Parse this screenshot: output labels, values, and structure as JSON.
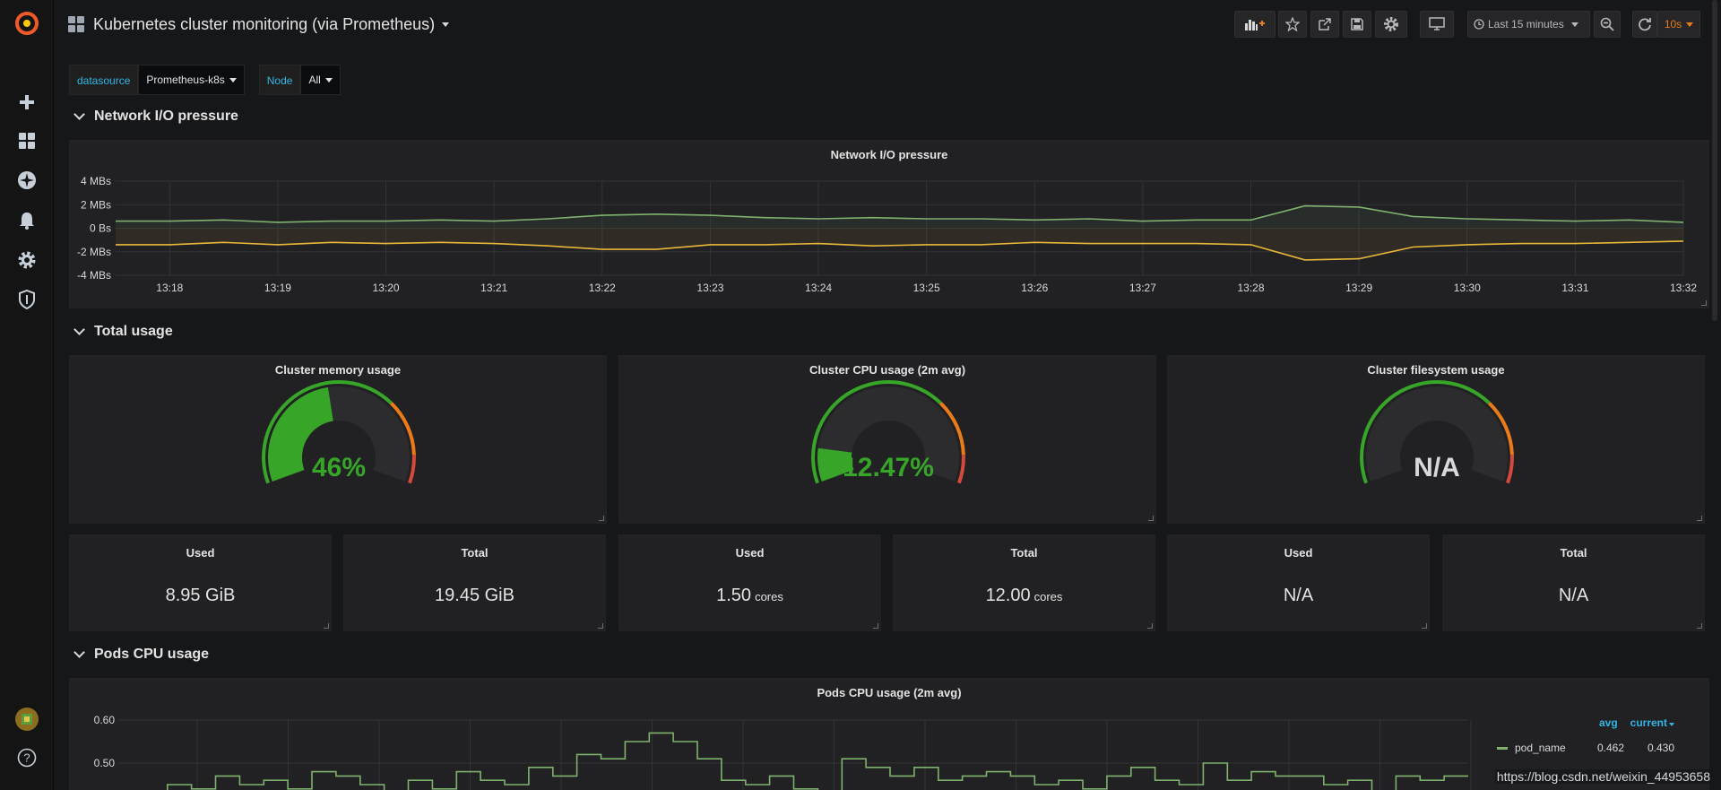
{
  "header": {
    "title": "Kubernetes cluster monitoring (via Prometheus)",
    "time_range": "Last 15 minutes",
    "refresh": "10s"
  },
  "variables": [
    {
      "label": "datasource",
      "value": "Prometheus-k8s"
    },
    {
      "label": "Node",
      "value": "All"
    }
  ],
  "rows": {
    "network": "Network I/O pressure",
    "total": "Total usage",
    "pods": "Pods CPU usage"
  },
  "network_panel": {
    "title": "Network I/O pressure",
    "y_ticks": [
      "4 MBs",
      "2 MBs",
      "0 Bs",
      "-2 MBs",
      "-4 MBs"
    ],
    "x_ticks": [
      "13:18",
      "13:19",
      "13:20",
      "13:21",
      "13:22",
      "13:23",
      "13:24",
      "13:25",
      "13:26",
      "13:27",
      "13:28",
      "13:29",
      "13:30",
      "13:31",
      "13:32"
    ]
  },
  "gauges": [
    {
      "title": "Cluster memory usage",
      "value_text": "46%",
      "fraction": 0.46,
      "color": "#37a628"
    },
    {
      "title": "Cluster CPU usage (2m avg)",
      "value_text": "12.47%",
      "fraction": 0.1247,
      "color": "#37a628"
    },
    {
      "title": "Cluster filesystem usage",
      "value_text": "N/A",
      "fraction": 0,
      "color": "#d8d9da"
    }
  ],
  "stats": [
    {
      "title": "Used",
      "value": "8.95 GiB",
      "unit": ""
    },
    {
      "title": "Total",
      "value": "19.45 GiB",
      "unit": ""
    },
    {
      "title": "Used",
      "value": "1.50",
      "unit": "cores"
    },
    {
      "title": "Total",
      "value": "12.00",
      "unit": "cores"
    },
    {
      "title": "Used",
      "value": "N/A",
      "unit": ""
    },
    {
      "title": "Total",
      "value": "N/A",
      "unit": ""
    }
  ],
  "pods_panel": {
    "title": "Pods CPU usage (2m avg)",
    "y_ticks": [
      "0.60",
      "0.50"
    ],
    "legend": {
      "avg_label": "avg",
      "current_label": "current",
      "series": [
        {
          "name": "pod_name",
          "avg": "0.462",
          "current": "0.430"
        }
      ]
    }
  },
  "colors": {
    "accent": "#33b5e5",
    "ok": "#37a628",
    "warn": "#eb7b18",
    "crit": "#d44a3a",
    "series_green": "#7eb26d",
    "series_yellow": "#eab839",
    "refresh": "#eb7b18"
  },
  "chart_data": [
    {
      "type": "line",
      "title": "Network I/O pressure",
      "x": [
        "13:17:30",
        "13:18",
        "13:18:30",
        "13:19",
        "13:19:30",
        "13:20",
        "13:20:30",
        "13:21",
        "13:21:30",
        "13:22",
        "13:22:30",
        "13:23",
        "13:23:30",
        "13:24",
        "13:24:30",
        "13:25",
        "13:25:30",
        "13:26",
        "13:26:30",
        "13:27",
        "13:27:30",
        "13:28",
        "13:28:30",
        "13:29",
        "13:29:30",
        "13:30",
        "13:30:30",
        "13:31",
        "13:31:30",
        "13:32"
      ],
      "series": [
        {
          "values": [
            0.6,
            0.6,
            0.7,
            0.5,
            0.6,
            0.6,
            0.7,
            0.6,
            0.8,
            1.1,
            1.2,
            1.1,
            0.9,
            0.8,
            0.9,
            0.8,
            0.8,
            0.7,
            0.8,
            0.6,
            0.7,
            0.7,
            1.9,
            1.8,
            1.0,
            0.8,
            0.7,
            0.6,
            0.7,
            0.5
          ]
        },
        {
          "values": [
            -1.4,
            -1.4,
            -1.2,
            -1.4,
            -1.2,
            -1.3,
            -1.2,
            -1.3,
            -1.5,
            -1.8,
            -1.8,
            -1.4,
            -1.4,
            -1.3,
            -1.5,
            -1.4,
            -1.4,
            -1.2,
            -1.3,
            -1.3,
            -1.3,
            -1.4,
            -2.7,
            -2.6,
            -1.6,
            -1.4,
            -1.3,
            -1.3,
            -1.2,
            -1.1
          ]
        }
      ],
      "ylabel": "",
      "ylim": [
        -4,
        4
      ]
    },
    {
      "type": "line",
      "title": "Pods CPU usage (2m avg)",
      "series": [
        {
          "name": "pod_name",
          "values": [
            0.42,
            0.43,
            0.45,
            0.44,
            0.47,
            0.45,
            0.46,
            0.44,
            0.48,
            0.47,
            0.45,
            0.43,
            0.46,
            0.44,
            0.48,
            0.46,
            0.45,
            0.49,
            0.47,
            0.52,
            0.51,
            0.55,
            0.57,
            0.55,
            0.51,
            0.46,
            0.45,
            0.47,
            0.44,
            0.43,
            0.51,
            0.49,
            0.47,
            0.49,
            0.46,
            0.47,
            0.48,
            0.47,
            0.45,
            0.46,
            0.44,
            0.47,
            0.49,
            0.46,
            0.45,
            0.5,
            0.46,
            0.48,
            0.47,
            0.47,
            0.45,
            0.46,
            0.43,
            0.47,
            0.46,
            0.47
          ]
        }
      ],
      "avg": 0.462,
      "current": 0.43,
      "ylim": [
        0.4,
        0.6
      ]
    }
  ],
  "watermark": "https://blog.csdn.net/weixin_44953658"
}
